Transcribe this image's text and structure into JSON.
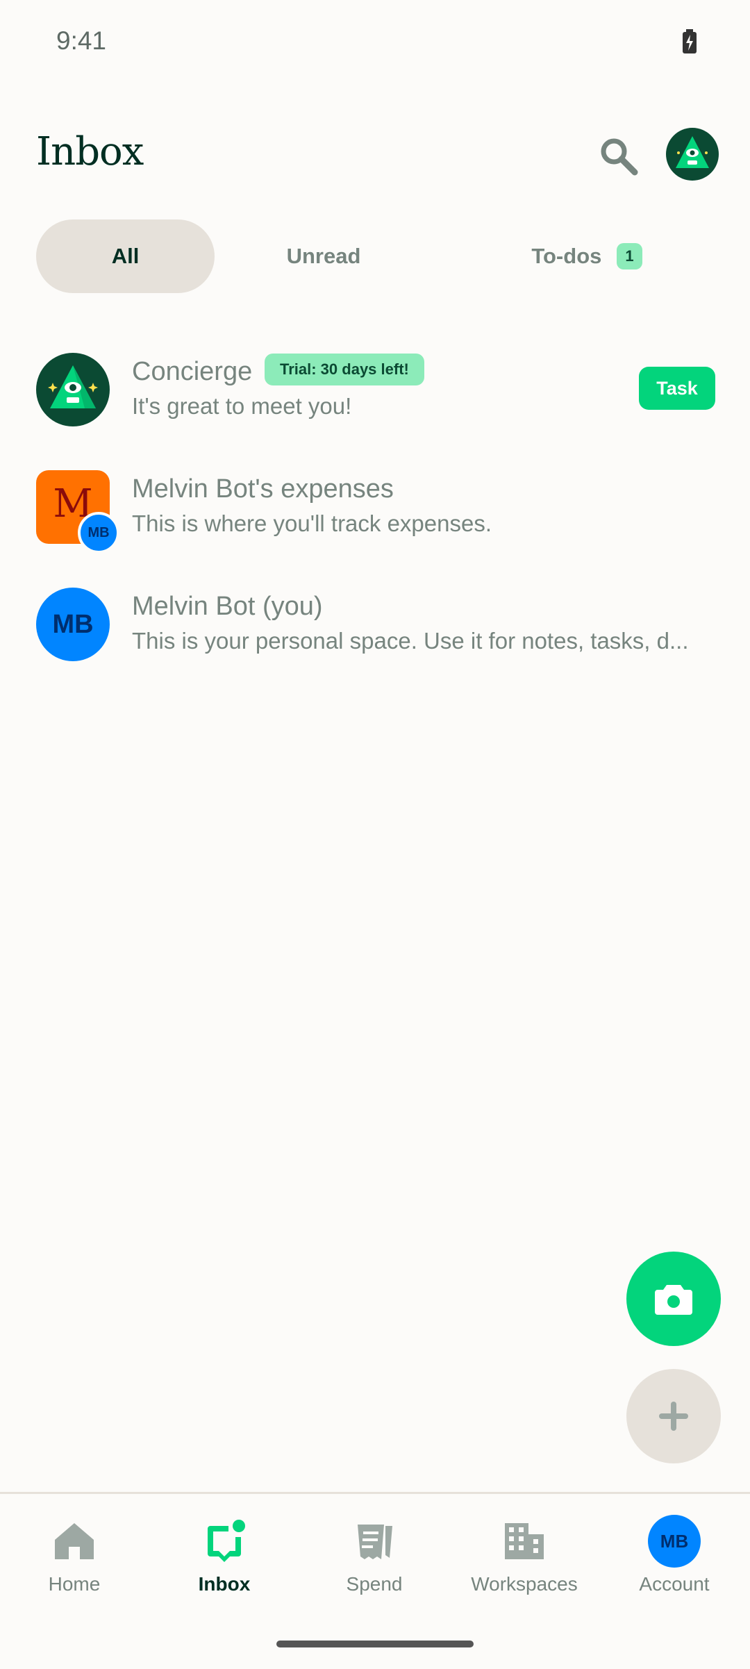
{
  "status_bar": {
    "time": "9:41"
  },
  "header": {
    "title": "Inbox"
  },
  "tabs": [
    {
      "label": "All",
      "active": true
    },
    {
      "label": "Unread",
      "active": false
    },
    {
      "label": "To-dos",
      "count": "1",
      "active": false
    }
  ],
  "chats": [
    {
      "title": "Concierge",
      "badge": "Trial: 30 days left!",
      "subtitle": "It's great to meet you!",
      "action": "Task"
    },
    {
      "title": "Melvin Bot's expenses",
      "subtitle": "This is where you'll track expenses.",
      "avatar_letter": "M",
      "sub_avatar_initials": "MB"
    },
    {
      "title": "Melvin Bot (you)",
      "subtitle": "This is your personal space. Use it for notes, tasks, d...",
      "avatar_initials": "MB"
    }
  ],
  "nav": [
    {
      "label": "Home",
      "icon": "home-icon"
    },
    {
      "label": "Inbox",
      "icon": "inbox-icon",
      "active": true
    },
    {
      "label": "Spend",
      "icon": "receipt-icon"
    },
    {
      "label": "Workspaces",
      "icon": "building-icon"
    },
    {
      "label": "Account",
      "icon": "avatar",
      "initials": "MB"
    }
  ],
  "colors": {
    "accent": "#03D47C",
    "badge": "#8CEBB9",
    "brand_dark": "#0B4A33",
    "blue": "#0185FF",
    "orange": "#FF7101",
    "text_muted": "#76847E"
  }
}
